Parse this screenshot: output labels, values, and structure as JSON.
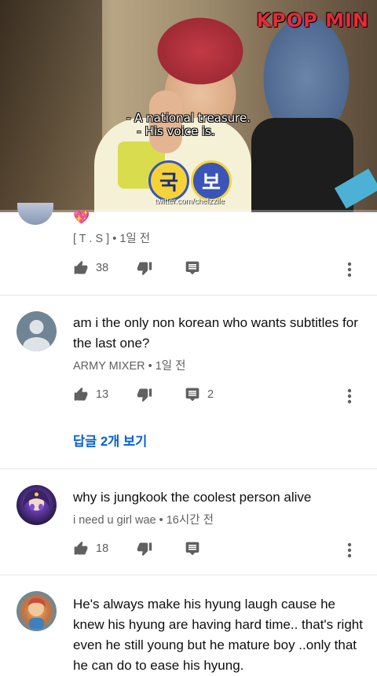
{
  "video": {
    "logo_text": "KPOP MIN",
    "subtitle_line1": "- A national treasure.",
    "subtitle_line2": "- His voice is.",
    "badge_left": "국",
    "badge_right": "보",
    "watermark": "twitter.com/chelzzile",
    "progress": 0
  },
  "comments": [
    {
      "id": "c0",
      "text": "💖",
      "author": "[ T . S ]",
      "time": "1일 전",
      "likes": "38",
      "replies_count": ""
    },
    {
      "id": "c1",
      "text": "am i the only non korean who wants subtitles for the last one?",
      "author": "ARMY MIXER",
      "time": "1일 전",
      "likes": "13",
      "replies_count": "2",
      "view_replies": "답글 2개 보기"
    },
    {
      "id": "c2",
      "text": "why is jungkook the coolest person alive",
      "author": "i need u girl wae",
      "time": "16시간 전",
      "likes": "18",
      "replies_count": ""
    },
    {
      "id": "c3",
      "text": "He's always make his hyung laugh cause he knew his hyung are having hard time.. that's right even he still young but he mature boy ..only that he can do to ease his hyung.",
      "author": "",
      "time": "",
      "likes": "",
      "replies_count": ""
    }
  ],
  "meta_separator": "•",
  "icons": {
    "like": "thumb-up-icon",
    "dislike": "thumb-down-icon",
    "reply": "comment-icon",
    "more": "more-vert-icon"
  },
  "colors": {
    "link": "#065fd4",
    "meta": "#606060",
    "progress": "#ff0000"
  }
}
